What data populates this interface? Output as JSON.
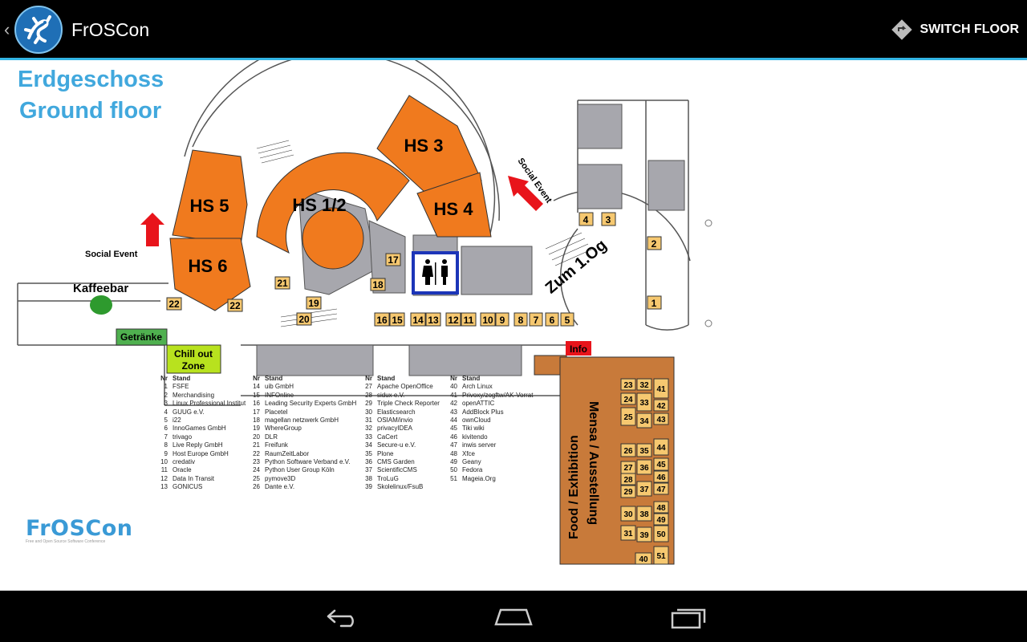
{
  "actionbar": {
    "title": "FrOSCon",
    "switch_floor_label": "SWITCH FLOOR"
  },
  "map": {
    "title_de": "Erdgeschoss",
    "title_en": "Ground floor",
    "rooms": {
      "hs12": "HS 1/2",
      "hs3": "HS 3",
      "hs4": "HS 4",
      "hs5": "HS 5",
      "hs6": "HS 6"
    },
    "social_event": "Social Event",
    "kaffeebar": "Kaffeebar",
    "getraenke": "Getränke",
    "chillout_1": "Chill out",
    "chillout_2": "Zone",
    "info": "Info",
    "stairs_label": "Zum 1.Og",
    "mensa_1": "Mensa / Ausstellung",
    "mensa_2": "Food / Exhibition",
    "logo": "FrOSCon",
    "logo_sub": "Free and Open Source Software Conference"
  },
  "stands_legend": {
    "col_nr": "Nr",
    "col_stand": "Stand",
    "columns": [
      [
        [
          "1",
          "FSFE"
        ],
        [
          "2",
          "Merchandising"
        ],
        [
          "3",
          "Linux Professional Institut"
        ],
        [
          "4",
          "GUUG e.V."
        ],
        [
          "5",
          "i22"
        ],
        [
          "6",
          "InnoGames GmbH"
        ],
        [
          "7",
          "trivago"
        ],
        [
          "8",
          "Live Reply GmbH"
        ],
        [
          "9",
          "Host Europe GmbH"
        ],
        [
          "10",
          "credativ"
        ],
        [
          "11",
          "Oracle"
        ],
        [
          "12",
          "Data In Transit"
        ],
        [
          "13",
          "GONICUS"
        ]
      ],
      [
        [
          "14",
          "uib GmbH"
        ],
        [
          "15",
          "INFOnline"
        ],
        [
          "16",
          "Leading Security Experts GmbH"
        ],
        [
          "17",
          "Placetel"
        ],
        [
          "18",
          "magellan netzwerk GmbH"
        ],
        [
          "19",
          "WhereGroup"
        ],
        [
          "20",
          "DLR"
        ],
        [
          "21",
          "Freifunk"
        ],
        [
          "22",
          "RaumZeitLabor"
        ],
        [
          "23",
          "Python Software Verband e.V."
        ],
        [
          "24",
          "Python User Group Köln"
        ],
        [
          "25",
          "pymove3D"
        ],
        [
          "26",
          "Dante e.V."
        ]
      ],
      [
        [
          "27",
          "Apache OpenOffice"
        ],
        [
          "28",
          "sidux e.V."
        ],
        [
          "29",
          "Triple Check Reporter"
        ],
        [
          "30",
          "Elasticsearch"
        ],
        [
          "31",
          "OSIAM/invio"
        ],
        [
          "32",
          "privacyIDEA"
        ],
        [
          "33",
          "CaCert"
        ],
        [
          "34",
          "Secure-u e.V."
        ],
        [
          "35",
          "Plone"
        ],
        [
          "36",
          "CMS Garden"
        ],
        [
          "37",
          "ScientificCMS"
        ],
        [
          "38",
          "TroLuG"
        ],
        [
          "39",
          "Skolelinux/FsuB"
        ]
      ],
      [
        [
          "40",
          "Arch Linux"
        ],
        [
          "41",
          "Privoxy/zogftw/AK-Vorrat"
        ],
        [
          "42",
          "openATTIC"
        ],
        [
          "43",
          "AddBlock Plus"
        ],
        [
          "44",
          "ownCloud"
        ],
        [
          "45",
          "Tiki wiki"
        ],
        [
          "46",
          "kivitendo"
        ],
        [
          "47",
          "inwis server"
        ],
        [
          "48",
          "Xfce"
        ],
        [
          "49",
          "Geany"
        ],
        [
          "50",
          "Fedora"
        ],
        [
          "51",
          "Mageia.Org"
        ]
      ]
    ]
  },
  "colors": {
    "actionbar_bg": "#000000",
    "accent": "#33b5e5",
    "lecture_hall": "#f07a1e",
    "stand": "#f6c870",
    "mensa": "#c87a3a",
    "wall_grey": "#a7a7ad",
    "info": "#e8141b",
    "getraenke": "#4fb04f",
    "chillout": "#b8e21e",
    "title_blue": "#41a8dd"
  },
  "icons": {
    "switch_floor": "layers-icon",
    "back": "back-icon",
    "home": "home-icon",
    "recents": "recents-icon"
  }
}
